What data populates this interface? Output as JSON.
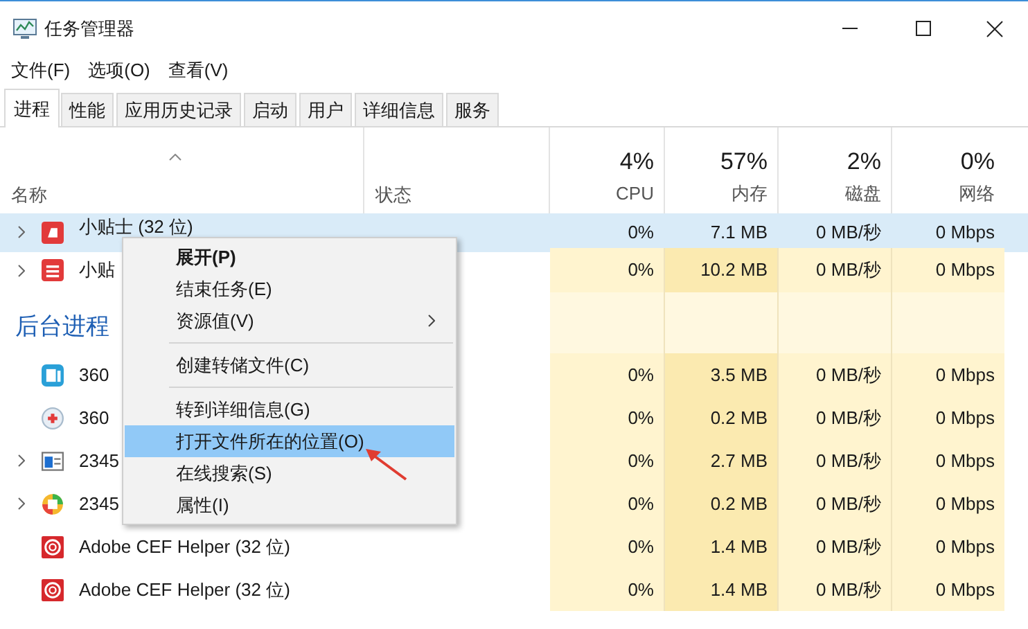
{
  "window": {
    "title": "任务管理器"
  },
  "menu_bar": [
    "文件(F)",
    "选项(O)",
    "查看(V)"
  ],
  "tabs": [
    {
      "label": "进程",
      "selected": true
    },
    {
      "label": "性能",
      "selected": false
    },
    {
      "label": "应用历史记录",
      "selected": false
    },
    {
      "label": "启动",
      "selected": false
    },
    {
      "label": "用户",
      "selected": false
    },
    {
      "label": "详细信息",
      "selected": false
    },
    {
      "label": "服务",
      "selected": false
    }
  ],
  "table": {
    "columns": [
      {
        "label": "名称"
      },
      {
        "label": "状态"
      },
      {
        "usage": "4%",
        "label": "CPU"
      },
      {
        "usage": "57%",
        "label": "内存"
      },
      {
        "usage": "2%",
        "label": "磁盘"
      },
      {
        "usage": "0%",
        "label": "网络"
      }
    ],
    "rows": [
      {
        "kind": "process",
        "expandable": true,
        "selected": true,
        "name": "小贴士 (32 位)",
        "cpu": "0%",
        "memory": "7.1 MB",
        "disk": "0 MB/秒",
        "network": "0 Mbps"
      },
      {
        "kind": "process",
        "expandable": true,
        "selected": false,
        "name": "小贴",
        "cpu": "0%",
        "memory": "10.2 MB",
        "disk": "0 MB/秒",
        "network": "0 Mbps"
      },
      {
        "kind": "group",
        "name": "后台进程"
      },
      {
        "kind": "process",
        "expandable": false,
        "selected": false,
        "name": "360",
        "cpu": "0%",
        "memory": "3.5 MB",
        "disk": "0 MB/秒",
        "network": "0 Mbps"
      },
      {
        "kind": "process",
        "expandable": false,
        "selected": false,
        "name": "360",
        "cpu": "0%",
        "memory": "0.2 MB",
        "disk": "0 MB/秒",
        "network": "0 Mbps"
      },
      {
        "kind": "process",
        "expandable": true,
        "selected": false,
        "name": "2345",
        "cpu": "0%",
        "memory": "2.7 MB",
        "disk": "0 MB/秒",
        "network": "0 Mbps"
      },
      {
        "kind": "process",
        "expandable": true,
        "selected": false,
        "name": "2345",
        "cpu": "0%",
        "memory": "0.2 MB",
        "disk": "0 MB/秒",
        "network": "0 Mbps"
      },
      {
        "kind": "process",
        "expandable": false,
        "selected": false,
        "name": "Adobe CEF Helper (32 位)",
        "cpu": "0%",
        "memory": "1.4 MB",
        "disk": "0 MB/秒",
        "network": "0 Mbps"
      },
      {
        "kind": "process",
        "expandable": false,
        "selected": false,
        "name": "Adobe CEF Helper (32 位)",
        "cpu": "0%",
        "memory": "1.4 MB",
        "disk": "0 MB/秒",
        "network": "0 Mbps"
      }
    ]
  },
  "context_menu": [
    {
      "kind": "item",
      "label": "展开(P)",
      "default": true,
      "submenu": false,
      "selected": false
    },
    {
      "kind": "item",
      "label": "结束任务(E)",
      "default": false,
      "submenu": false,
      "selected": false
    },
    {
      "kind": "item",
      "label": "资源值(V)",
      "default": false,
      "submenu": true,
      "selected": false
    },
    {
      "kind": "separator"
    },
    {
      "kind": "item",
      "label": "创建转储文件(C)",
      "default": false,
      "submenu": false,
      "selected": false
    },
    {
      "kind": "separator"
    },
    {
      "kind": "item",
      "label": "转到详细信息(G)",
      "default": false,
      "submenu": false,
      "selected": false
    },
    {
      "kind": "item",
      "label": "打开文件所在的位置(O)",
      "default": false,
      "submenu": false,
      "selected": true
    },
    {
      "kind": "item",
      "label": "在线搜索(S)",
      "default": false,
      "submenu": false,
      "selected": false
    },
    {
      "kind": "item",
      "label": "属性(I)",
      "default": false,
      "submenu": false,
      "selected": false
    }
  ]
}
